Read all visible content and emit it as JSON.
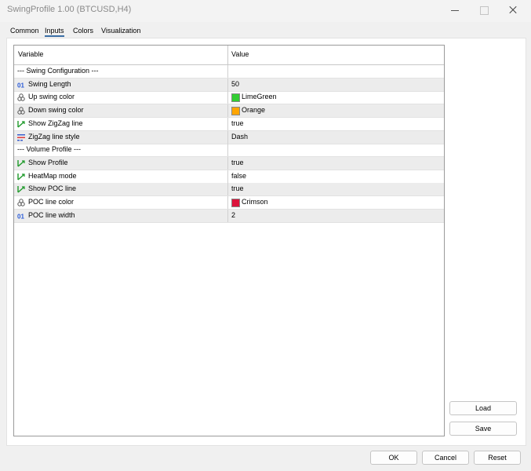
{
  "window": {
    "title": "SwingProfile 1.00 (BTCUSD,H4)",
    "min_icon": "minimize-icon",
    "max_icon": "maximize-icon",
    "close_icon": "close-icon"
  },
  "tabs": [
    {
      "label": "Common"
    },
    {
      "label": "Inputs",
      "active": true
    },
    {
      "label": "Colors"
    },
    {
      "label": "Visualization"
    }
  ],
  "grid": {
    "headers": {
      "variable": "Variable",
      "value": "Value"
    },
    "rows": [
      {
        "label": "--- Swing Configuration ---",
        "value": "",
        "icon": "none",
        "section": true
      },
      {
        "label": "Swing Length",
        "value": "50",
        "icon": "integer-icon"
      },
      {
        "label": "Up swing color",
        "value": "LimeGreen",
        "icon": "color-icon",
        "swatch": "#32cd32"
      },
      {
        "label": "Down swing color",
        "value": "Orange",
        "icon": "color-icon",
        "swatch": "#ffa500"
      },
      {
        "label": "Show ZigZag line",
        "value": "true",
        "icon": "boolean-icon"
      },
      {
        "label": "ZigZag line style",
        "value": "Dash",
        "icon": "line-style-icon"
      },
      {
        "label": "--- Volume Profile ---",
        "value": "",
        "icon": "none",
        "section": true
      },
      {
        "label": "Show Profile",
        "value": "true",
        "icon": "boolean-icon"
      },
      {
        "label": "HeatMap mode",
        "value": "false",
        "icon": "boolean-icon"
      },
      {
        "label": "Show POC line",
        "value": "true",
        "icon": "boolean-icon"
      },
      {
        "label": "POC line color",
        "value": "Crimson",
        "icon": "color-icon",
        "swatch": "#dc143c"
      },
      {
        "label": "POC line width",
        "value": "2",
        "icon": "integer-icon"
      }
    ]
  },
  "buttons": {
    "load": "Load",
    "save": "Save",
    "ok": "OK",
    "cancel": "Cancel",
    "reset": "Reset"
  },
  "colors": {
    "accent": "#3a6ea5",
    "integer_icon": "#2a5bd7",
    "boolean_icon": "#1f9a2b"
  }
}
